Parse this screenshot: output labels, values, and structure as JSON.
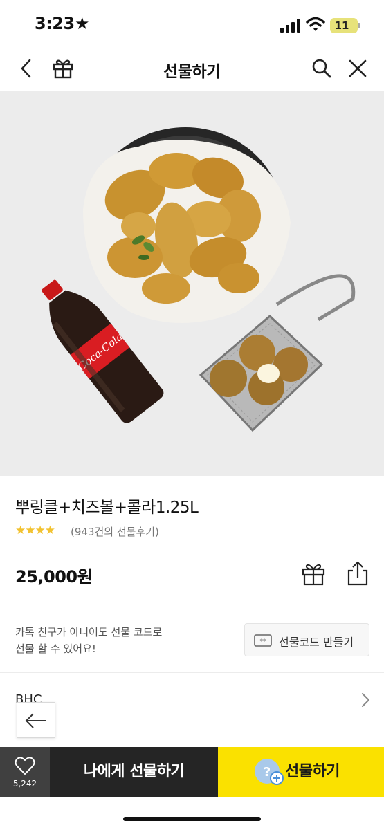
{
  "status_bar": {
    "time": "3:23",
    "battery": "11"
  },
  "header": {
    "title": "선물하기"
  },
  "product": {
    "name": "뿌링클+치즈볼+콜라1.25L",
    "rating_stars": "★★★★",
    "rating_count_text": "(943건의 선물후기)",
    "price": "25,000원"
  },
  "gift_code": {
    "notice_line1": "카톡 친구가 아니어도 선물 코드로",
    "notice_line2": "선물 할 수 있어요!",
    "button_label": "선물코드 만들기"
  },
  "brand": {
    "name": "BHC"
  },
  "bottom_bar": {
    "like_count": "5,242",
    "gift_myself_label": "나에게 선물하기",
    "gift_label": "선물하기"
  },
  "colors": {
    "accent_yellow": "#fae100",
    "dark_button": "#252525",
    "like_box": "#404040",
    "star": "#f2c230"
  },
  "icons": [
    "star-icon",
    "signal-icon",
    "wifi-icon",
    "back-icon",
    "gift-icon",
    "search-icon",
    "close-icon",
    "share-icon",
    "ticket-icon",
    "chevron-right-icon",
    "arrow-left-icon",
    "heart-icon",
    "friend-add-icon"
  ]
}
